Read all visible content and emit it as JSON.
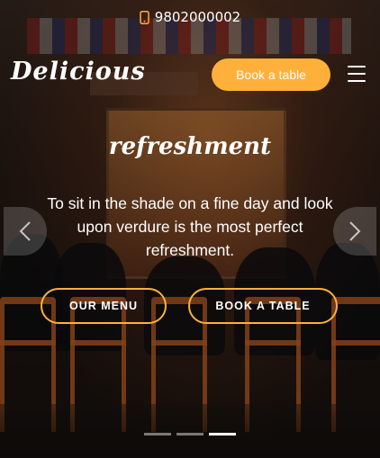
{
  "topbar": {
    "phone": "9802000002",
    "phone_icon": "phone-icon"
  },
  "header": {
    "logo": "Delicious",
    "book_label": "Book a table",
    "menu_icon": "hamburger-menu-icon"
  },
  "hero": {
    "title": "refreshment",
    "text": "To sit in the shade on a fine day and look upon verdure is the most perfect refreshment.",
    "menu_cta": "OUR MENU",
    "book_cta": "BOOK A TABLE"
  },
  "carousel": {
    "slides": 3,
    "active_index": 2
  },
  "colors": {
    "accent": "#ffb03b",
    "text": "#ffffff"
  }
}
